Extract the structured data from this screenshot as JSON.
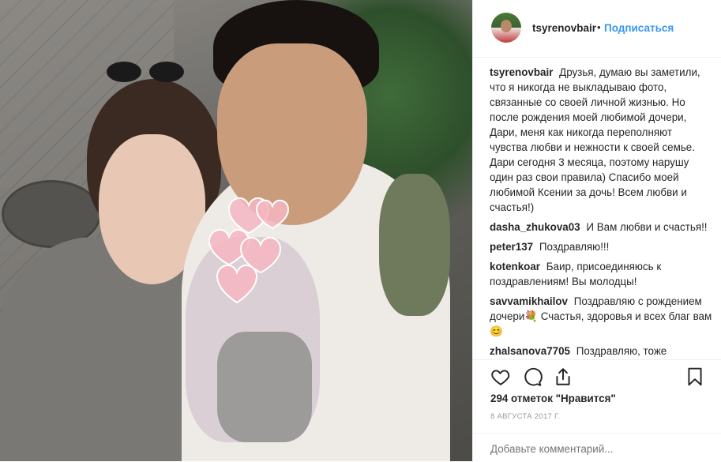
{
  "header": {
    "username": "tsyrenovbair",
    "separator": "•",
    "follow_label": "Подписаться"
  },
  "caption": {
    "author": "tsyrenovbair",
    "text": "Друзья, думаю вы заметили, что я никогда не выкладываю фото, связанные со своей личной жизнью. Но после рождения моей любимой дочери, Дари, меня как никогда переполняют чувства любви и нежности к своей семье. Дари сегодня 3 месяца, поэтому нарушу один раз свои правила) Спасибо моей любимой Ксении за дочь! Всем любви и счастья!)"
  },
  "comments": [
    {
      "author": "dasha_zhukova03",
      "text": "И Вам любви и счастья!!"
    },
    {
      "author": "peter137",
      "text": "Поздравляю!!!"
    },
    {
      "author": "kotenkoar",
      "text": "Баир, присоединяюсь к поздравлениям! Вы молодцы!"
    },
    {
      "author": "savvamikhailov",
      "text": "Поздравляю с рождением дочери💐 Счастья, здоровья и всех благ вам😊"
    },
    {
      "author": "zhalsanova7705",
      "text": "Поздравляю, тоже"
    }
  ],
  "actions": {
    "like_icon": "heart-outline-icon",
    "comment_icon": "comment-bubble-icon",
    "share_icon": "share-icon",
    "save_icon": "bookmark-icon"
  },
  "likes_text": "294 отметок \"Нравится\"",
  "date_text": "8 АВГУСТА 2017 Г.",
  "add_comment_placeholder": "Добавьте комментарий...",
  "colors": {
    "link_blue": "#3897f0",
    "text": "#262626",
    "muted": "#999999",
    "divider": "#efefef"
  }
}
